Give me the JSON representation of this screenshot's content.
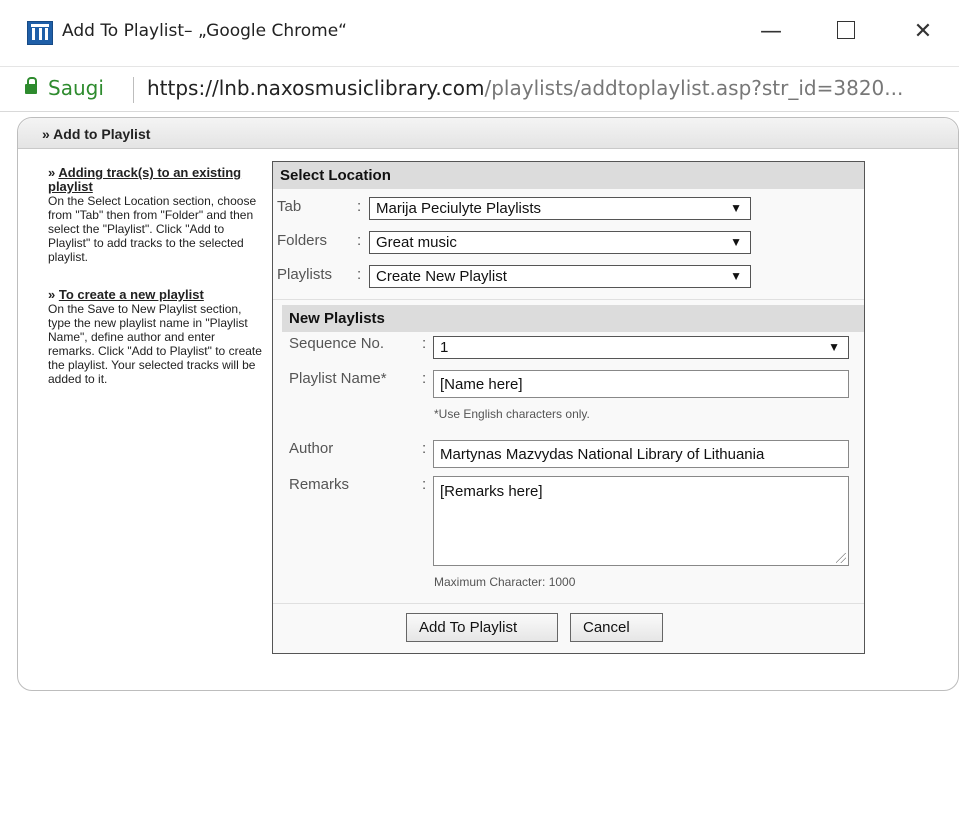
{
  "window": {
    "title": "Add To Playlist– „Google Chrome“",
    "minimize": "—",
    "close": "✕"
  },
  "address": {
    "secure_label": "Saugi",
    "url_host": "https://lnb.naxosmusiclibrary.com",
    "url_path": "/playlists/addtoplaylist.asp?str_id=3820..."
  },
  "page": {
    "header": "» Add to Playlist"
  },
  "help": {
    "section1_prefix": "» ",
    "section1_title": "Adding track(s) to an existing playlist",
    "section1_text": "On the Select Location section, choose from \"Tab\" then from \"Folder\" and then select the \"Playlist\". Click \"Add to Playlist\" to add tracks to the selected playlist.",
    "section2_prefix": "» ",
    "section2_title": "To create a new playlist",
    "section2_text": "On the Save to New Playlist section, type the new playlist name in \"Playlist Name\", define author and enter remarks. Click \"Add to Playlist\" to create the playlist. Your selected tracks will be added to it."
  },
  "select_location": {
    "heading": "Select Location",
    "tab_label": "Tab",
    "tab_value": "Marija Peciulyte Playlists",
    "folders_label": "Folders",
    "folders_value": "Great music",
    "playlists_label": "Playlists",
    "playlists_value": "Create New Playlist"
  },
  "new_playlists": {
    "heading": "New Playlists",
    "sequence_label": "Sequence No.",
    "sequence_value": "1",
    "name_label": "Playlist Name*",
    "name_value": "[Name here]",
    "name_note": "*Use English characters only.",
    "author_label": "Author",
    "author_value": "Martynas Mazvydas National Library of Lithuania",
    "remarks_label": "Remarks",
    "remarks_value": "[Remarks here]",
    "max_note": "Maximum Character: 1000"
  },
  "buttons": {
    "add": "Add To Playlist",
    "cancel": "Cancel"
  },
  "colon": ":",
  "arrow": "▼"
}
